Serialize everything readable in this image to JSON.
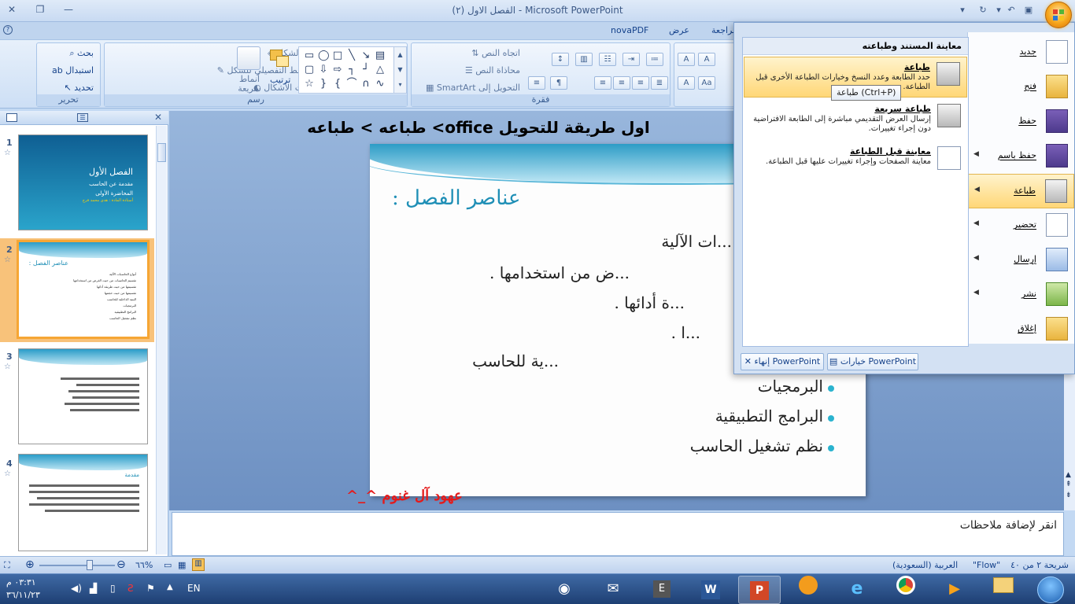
{
  "window": {
    "title": "الفصل الاول  (٢) - Microsoft PowerPoint"
  },
  "tabs": [
    "novaPDF",
    "عرض",
    "مراجعة"
  ],
  "ribbon": {
    "editing": {
      "label": "تحرير",
      "find": "بحث",
      "replace": "استبدال",
      "select": "تحديد"
    },
    "drawing": {
      "label": "رسم",
      "shape_fill": "تعبئة الشكل",
      "shape_outline": "المخطط التفصيلي للشكل",
      "shape_effects": "تأثيرات الأشكال",
      "quick_styles": "أنماط سريعة",
      "arrange": "ترتيب"
    },
    "paragraph": {
      "label": "فقرة",
      "text_direction": "اتجاه النص",
      "align_text": "محاذاة النص",
      "smartart": "التحويل إلى SmartArt"
    }
  },
  "slides_pane": {
    "slides": [
      {
        "number": "1",
        "title": "الفصل الأول",
        "lines": [
          "مقدمة عن الحاسب",
          "المحاضرة الأولى",
          "أستاذة المادة : هدى محمد فرج"
        ]
      },
      {
        "number": "2",
        "title": "عناصر الفصل :",
        "lines": [
          "أنواع الحاسبات الآلية",
          "تقسيم الحاسبات من حيث الغرض من استخدامها",
          "تقسيمها من حيث طريقة أدائها",
          "تقسيمها من حيث حجمها",
          "البنية الداخلية للحاسب",
          "البرمجيات",
          "البرامج التطبيقية",
          "نظم تشغيل الحاسب"
        ]
      },
      {
        "number": "3",
        "title": "",
        "lines": []
      },
      {
        "number": "4",
        "title": "مقدمة",
        "lines": []
      }
    ]
  },
  "slide": {
    "title": "عناصر الفصل :",
    "bullets": [
      "...ات الآلية",
      "...ض من استخدامها .",
      "...ة أدائها .",
      "...ا .",
      "...ية للحاسب",
      "البرمجيات",
      "البرامج التطبيقية",
      "نظم تشغيل الحاسب"
    ]
  },
  "overlay": {
    "instruction": "اول طريقة للتحويل office> طباعه > طباعه",
    "signature": "عهود آل غنوم ^_^"
  },
  "notes": {
    "placeholder": "انقر لإضافة ملاحظات"
  },
  "statusbar": {
    "slide_indicator": "شريحة ٢ من ٤٠",
    "theme": "\"Flow\"",
    "language": "العربية (السعودية)",
    "zoom": "٦٦%"
  },
  "office_menu": {
    "items": [
      {
        "label": "جديد",
        "icon": "new-document-icon",
        "has_arrow": false
      },
      {
        "label": "فتح",
        "icon": "open-folder-icon",
        "has_arrow": false
      },
      {
        "label": "حفظ",
        "icon": "save-disk-icon",
        "has_arrow": false
      },
      {
        "label": "حفظ باسم",
        "icon": "save-as-icon",
        "has_arrow": true
      },
      {
        "label": "طباعة",
        "icon": "printer-icon",
        "has_arrow": true
      },
      {
        "label": "تحضير",
        "icon": "prepare-icon",
        "has_arrow": true
      },
      {
        "label": "إرسال",
        "icon": "send-icon",
        "has_arrow": true
      },
      {
        "label": "نشر",
        "icon": "publish-icon",
        "has_arrow": true
      },
      {
        "label": "إغلاق",
        "icon": "close-folder-icon",
        "has_arrow": false
      }
    ],
    "submenu": {
      "header": "معاينة المستند وطباعته",
      "items": [
        {
          "title": "طباعة",
          "desc": "حدد الطابعة وعدد النسخ وخيارات الطباعة الأخرى قبل الطباعة."
        },
        {
          "title": "طباعة سريعة",
          "desc": "إرسال العرض التقديمي مباشرة إلى الطابعة الافتراضية دون إجراء تغييرات."
        },
        {
          "title": "معاينة قبل الطباعة",
          "desc": "معاينة الصفحات وإجراء تغييرات عليها قبل الطباعة."
        }
      ]
    },
    "tooltip": "طباعة (Ctrl+P)",
    "options_button": "خيارات PowerPoint",
    "exit_button": "إنهاء PowerPoint"
  },
  "taskbar": {
    "language": "EN",
    "time": "٠٣:٣١ م",
    "date": "٣٦/١١/٢٣"
  },
  "colors": {
    "accent": "#f6a634",
    "slide_title": "#1f8fb6",
    "signature": "#e51a1a",
    "menu_highlight": "#ffd777"
  }
}
